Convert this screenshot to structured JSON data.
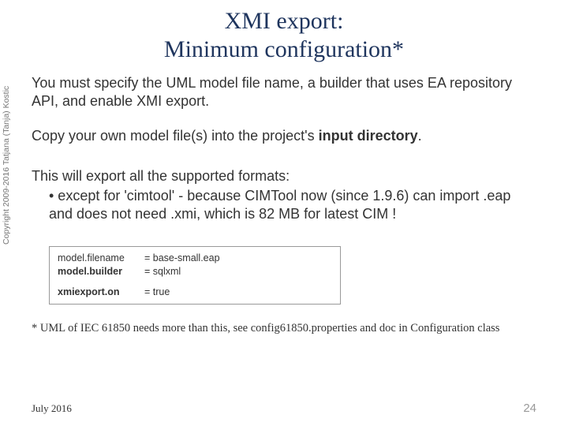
{
  "title": {
    "line1": "XMI export:",
    "line2": "Minimum configuration*"
  },
  "paragraphs": {
    "intro": "You must specify the UML model file name, a builder that uses EA repository API, and enable XMI export.",
    "copy_pre": "Copy your own model file(s) into the project's ",
    "copy_bold": "input directory",
    "copy_post": ".",
    "bullet_lead": "This will export all the supported formats:",
    "bullet_item": "•   except for 'cimtool' - because CIMTool now (since 1.9.6) can import .eap and does not need .xmi, which is 82 MB for latest CIM !"
  },
  "config": {
    "row1": {
      "key": "model.filename",
      "val": "= base-small.eap"
    },
    "row2": {
      "key": "model.builder",
      "val": "= sqlxml"
    },
    "row3": {
      "key": "xmiexport.on",
      "val": "= true"
    }
  },
  "footnote": "* UML of IEC 61850 needs more than this, see config61850.properties and doc in Configuration class",
  "copyright": "Copyright 2009-2016 Tatjana (Tanja) Kostic",
  "footer": {
    "date": "July 2016",
    "page": "24"
  }
}
